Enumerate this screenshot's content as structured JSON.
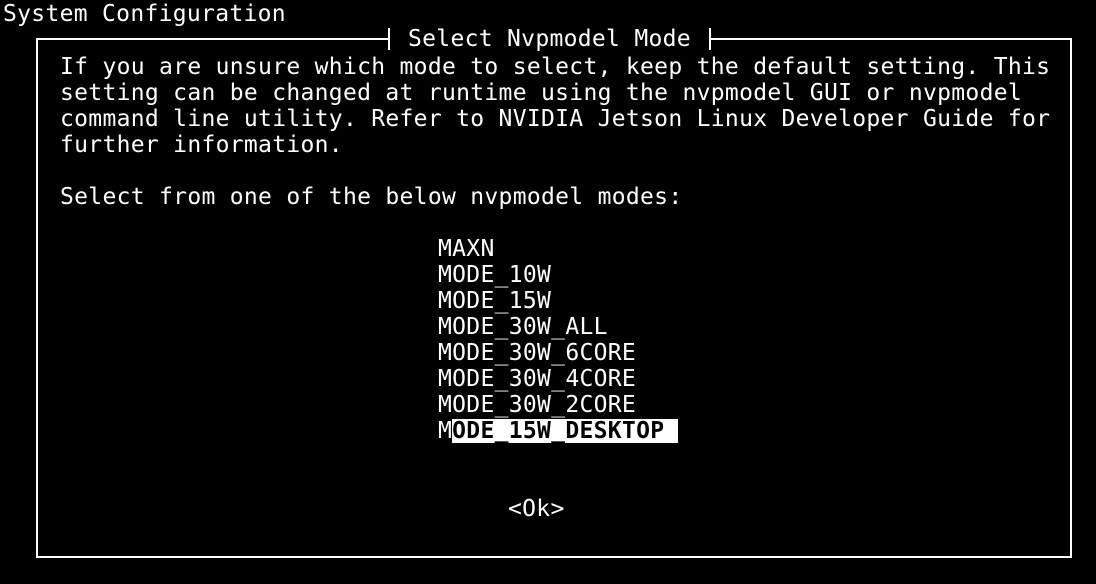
{
  "screen_title": "System Configuration",
  "dialog": {
    "title": "Select Nvpmodel Mode",
    "description_lines": [
      "If you are unsure which mode to select, keep the default setting. This",
      "setting can be changed at runtime using the nvpmodel GUI or nvpmodel",
      "command line utility. Refer to NVIDIA Jetson Linux Developer Guide for",
      "further information."
    ],
    "prompt": "Select from one of the below nvpmodel modes:",
    "modes": [
      {
        "label": "MAXN"
      },
      {
        "label": "MODE_10W"
      },
      {
        "label": "MODE_15W"
      },
      {
        "label": "MODE_30W_ALL"
      },
      {
        "label": "MODE_30W_6CORE"
      },
      {
        "label": "MODE_30W_4CORE"
      },
      {
        "label": "MODE_30W_2CORE"
      },
      {
        "label": "MODE_15W_DESKTOP",
        "first_char": "M",
        "rest": "ODE_15W_DESKTOP",
        "selected": true
      }
    ],
    "ok_label": "<Ok>"
  },
  "colors": {
    "background": "#000000",
    "foreground": "#ffffff",
    "highlight_bg": "#ffffff",
    "highlight_fg": "#000000"
  }
}
